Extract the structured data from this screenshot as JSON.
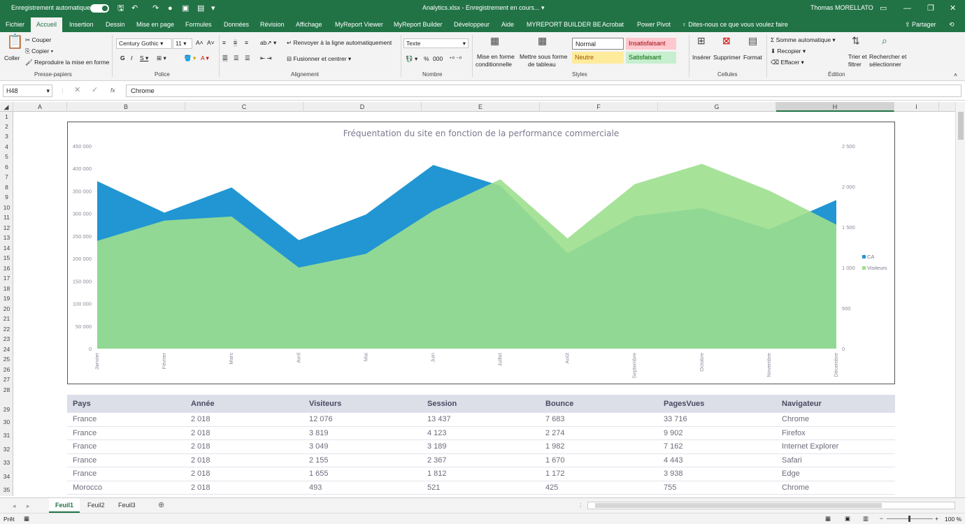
{
  "titlebar": {
    "autosave": "Enregistrement automatique",
    "file": "Analytics.xlsx  -  Enregistrement en cours...  ▾",
    "user": "Thomas MORELLATO"
  },
  "tabs": [
    "Fichier",
    "Accueil",
    "Insertion",
    "Dessin",
    "Mise en page",
    "Formules",
    "Données",
    "Révision",
    "Affichage",
    "MyReport Viewer",
    "MyReport Builder",
    "Développeur",
    "Aide",
    "MYREPORT BUILDER BE",
    "Acrobat",
    "Power Pivot",
    "Dites-nous ce que vous voulez faire"
  ],
  "share": "Partager",
  "ribbon": {
    "clipboard": {
      "paste": "Coller",
      "cut": "Couper",
      "copy": "Copier",
      "painter": "Reproduire la mise en forme",
      "group": "Presse-papiers"
    },
    "font": {
      "name": "Century Gothic",
      "size": "11",
      "group": "Police"
    },
    "align": {
      "wrap": "Renvoyer à la ligne automatiquement",
      "merge": "Fusionner et centrer",
      "group": "Alignement"
    },
    "number": {
      "format": "Texte",
      "group": "Nombre"
    },
    "styles": {
      "cond1": "Mise en forme",
      "cond2": "conditionnelle",
      "table1": "Mettre sous forme",
      "table2": "de tableau",
      "normal": "Normal",
      "bad": "Insatisfaisant",
      "neutral": "Neutre",
      "good": "Satisfaisant",
      "group": "Styles"
    },
    "cells": {
      "insert": "Insérer",
      "delete": "Supprimer",
      "format": "Format",
      "group": "Cellules"
    },
    "edit": {
      "autosum": "Somme automatique",
      "fill": "Recopier",
      "clear": "Effacer",
      "sort1": "Trier et",
      "sort2": "filtrer",
      "find1": "Rechercher et",
      "find2": "sélectionner",
      "group": "Édition"
    }
  },
  "formula": {
    "namebox": "H48",
    "value": "Chrome"
  },
  "columns": [
    "A",
    "B",
    "C",
    "D",
    "E",
    "F",
    "G",
    "H",
    "I"
  ],
  "rows": [
    "1",
    "2",
    "3",
    "4",
    "5",
    "6",
    "7",
    "8",
    "9",
    "10",
    "11",
    "12",
    "13",
    "14",
    "15",
    "16",
    "17",
    "18",
    "19",
    "20",
    "21",
    "22",
    "23",
    "24",
    "25",
    "26",
    "27",
    "28",
    "29",
    "30",
    "31",
    "32",
    "33",
    "34",
    "35"
  ],
  "chart_data": {
    "type": "area",
    "title": "Fréquentation du site en fonction de la performance commerciale",
    "categories": [
      "Janvier",
      "Février",
      "Mars",
      "Avril",
      "Mai",
      "Juin",
      "Juillet",
      "Août",
      "Septembre",
      "Octobre",
      "Novembre",
      "Décembre"
    ],
    "series": [
      {
        "name": "CA",
        "axis": "left",
        "color": "#2196d3",
        "values": [
          372000,
          302000,
          358000,
          241000,
          298000,
          408000,
          362000,
          212000,
          294000,
          312000,
          265000,
          330000
        ]
      },
      {
        "name": "Visiteurs",
        "axis": "right",
        "color": "#9ddf8e",
        "values": [
          1330,
          1580,
          1630,
          1000,
          1170,
          1700,
          2090,
          1360,
          2030,
          2280,
          1950,
          1530
        ]
      }
    ],
    "yticks": [
      "450 000",
      "400 000",
      "350 000",
      "300 000",
      "250 000",
      "200 000",
      "150 000",
      "100 000",
      "50 000",
      "0"
    ],
    "y2ticks": [
      "2 500",
      "2 000",
      "1 500",
      "1 000",
      "500",
      "0"
    ],
    "ylim": [
      0,
      450000
    ],
    "y2lim": [
      0,
      2500
    ],
    "legend_position": "right",
    "grid": false
  },
  "table": {
    "headers": [
      "Pays",
      "Année",
      "Visiteurs",
      "Session",
      "Bounce",
      "PagesVues",
      "Navigateur"
    ],
    "rows": [
      [
        "France",
        "2 018",
        "12 076",
        "13 437",
        "7 683",
        "33 716",
        "Chrome"
      ],
      [
        "France",
        "2 018",
        "3 819",
        "4 123",
        "2 274",
        "9 902",
        "Firefox"
      ],
      [
        "France",
        "2 018",
        "3 049",
        "3 189",
        "1 982",
        "7 162",
        "Internet Explorer"
      ],
      [
        "France",
        "2 018",
        "2 155",
        "2 367",
        "1 670",
        "4 443",
        "Safari"
      ],
      [
        "France",
        "2 018",
        "1 655",
        "1 812",
        "1 172",
        "3 938",
        "Edge"
      ],
      [
        "Morocco",
        "2 018",
        "493",
        "521",
        "425",
        "755",
        "Chrome"
      ]
    ]
  },
  "sheets": [
    "Feuil1",
    "Feuil2",
    "Feuil3"
  ],
  "status": {
    "ready": "Prêt",
    "zoom": "100 %"
  }
}
